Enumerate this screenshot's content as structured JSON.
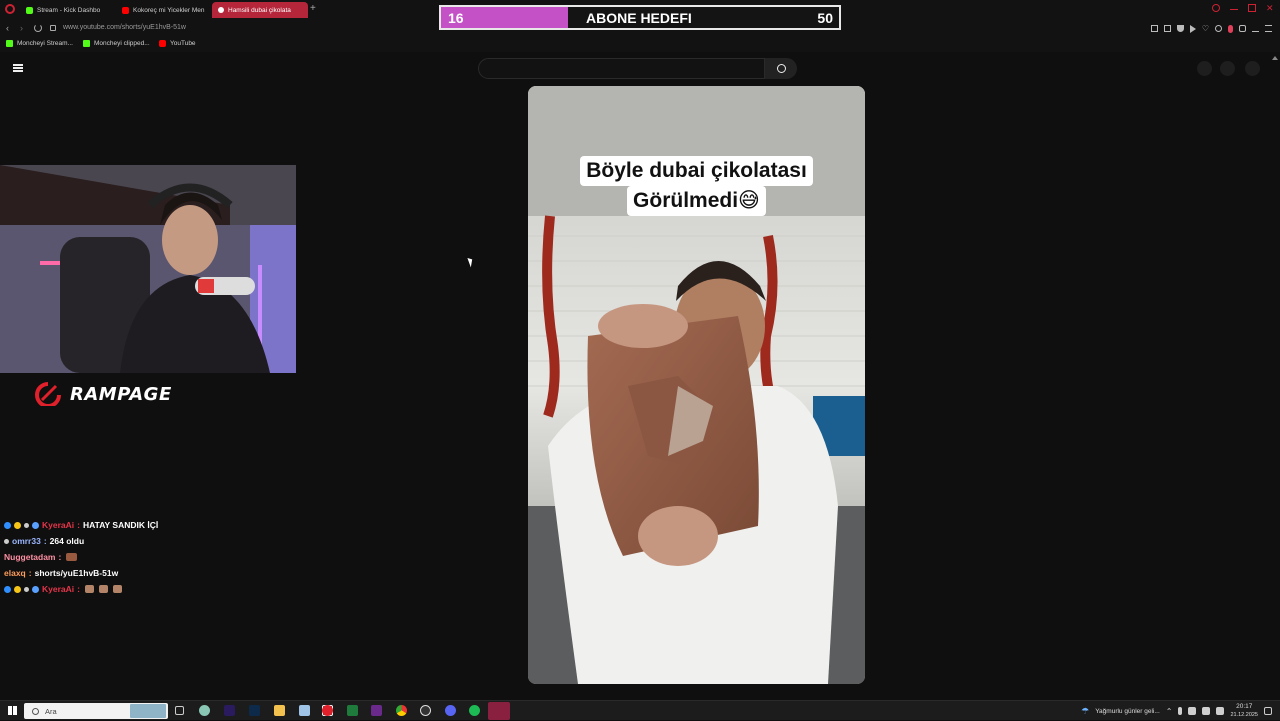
{
  "browser": {
    "tabs": [
      {
        "label": "Stream - Kick Dashbo",
        "color": "#53fc18"
      },
      {
        "label": "Kokoreç mi Yicekler Men",
        "color": "#ff0000"
      },
      {
        "label": "Hamsili dubai çikolata",
        "color": "#ff0000"
      }
    ],
    "url": "www.youtube.com/shorts/yuE1hvB-51w",
    "bookmarks": [
      {
        "label": "Moncheyi Stream...",
        "color": "#53fc18"
      },
      {
        "label": "Moncheyi clipped...",
        "color": "#53fc18"
      },
      {
        "label": "YouTube",
        "color": "#ff0000"
      }
    ]
  },
  "goal": {
    "current": "16",
    "label": "ABONE HEDEFI",
    "target": "50",
    "progress_fraction": 0.32,
    "fill_color": "#c452c6"
  },
  "video": {
    "caption_line1": "Böyle dubai çikolatası",
    "caption_line2": "Görülmedi😅"
  },
  "sponsor": {
    "name": "RAMPAGE"
  },
  "chat": [
    {
      "user": "KyeraAi",
      "user_color": "#e8344a",
      "text": "HATAY SANDIK İÇİ",
      "badges": [
        "#2f8fff",
        "#f5c518",
        "#cccccc",
        "#5aa0ff"
      ]
    },
    {
      "user": "omrr33",
      "user_color": "#9bb6ff",
      "text": "264 oldu",
      "badges": [
        "#cccccc"
      ]
    },
    {
      "user": "Nuggetadam",
      "user_color": "#ff8fa3",
      "text": "",
      "badges": [],
      "emotes": 1
    },
    {
      "user": "elaxq",
      "user_color": "#ff9d5c",
      "text": "shorts/yuE1hvB-51w",
      "badges": []
    },
    {
      "user": "KyeraAi",
      "user_color": "#e8344a",
      "text": "",
      "badges": [
        "#2f8fff",
        "#f5c518",
        "#cccccc",
        "#5aa0ff"
      ],
      "emotes": 3
    }
  ],
  "taskbar": {
    "search_placeholder": "Ara",
    "weather": "Yağmurlu günler geli...",
    "time": "20:17",
    "date": "21.12.2025"
  }
}
